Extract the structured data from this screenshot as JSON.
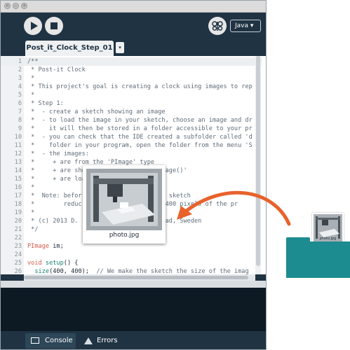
{
  "toolbar": {
    "mode_label": "Java ▾"
  },
  "tabs": {
    "sketch_tab": "Post_it_Clock_Step_01",
    "tab_menu_glyph": "▾"
  },
  "code_lines": [
    {
      "n": "1",
      "parts": [
        {
          "c": "cm",
          "t": "/**"
        }
      ]
    },
    {
      "n": "2",
      "parts": [
        {
          "c": "cm",
          "t": " * Post-it Clock"
        }
      ]
    },
    {
      "n": "3",
      "parts": [
        {
          "c": "cm",
          "t": " *"
        }
      ]
    },
    {
      "n": "4",
      "parts": [
        {
          "c": "cm",
          "t": " * This project's goal is creating a clock using images to rep"
        }
      ]
    },
    {
      "n": "5",
      "parts": [
        {
          "c": "cm",
          "t": " *"
        }
      ]
    },
    {
      "n": "6",
      "parts": [
        {
          "c": "cm",
          "t": " * Step 1:"
        }
      ]
    },
    {
      "n": "7",
      "parts": [
        {
          "c": "cm",
          "t": " *  - create a sketch showing an image"
        }
      ]
    },
    {
      "n": "8",
      "parts": [
        {
          "c": "cm",
          "t": " *  - to load the image in your sketch, choose an image and dr"
        }
      ]
    },
    {
      "n": "9",
      "parts": [
        {
          "c": "cm",
          "t": " *    it will then be stored in a folder accessible to your pr"
        }
      ]
    },
    {
      "n": "10",
      "parts": [
        {
          "c": "cm",
          "t": " *  - you can check that the IDE created a subfolder called 'd"
        }
      ]
    },
    {
      "n": "11",
      "parts": [
        {
          "c": "cm",
          "t": " *    folder in your program, open the folder from the menu 'S"
        }
      ]
    },
    {
      "n": "12",
      "parts": [
        {
          "c": "cm",
          "t": " *  - the images:"
        }
      ]
    },
    {
      "n": "13",
      "parts": [
        {
          "c": "cm",
          "t": " *     + are from the 'PImage' type"
        }
      ]
    },
    {
      "n": "14",
      "parts": [
        {
          "c": "cm",
          "t": " *     + are sho                   'image()'"
        }
      ]
    },
    {
      "n": "15",
      "parts": [
        {
          "c": "cm",
          "t": " *     + are loa                 )'"
        }
      ]
    },
    {
      "n": "16",
      "parts": [
        {
          "c": "cm",
          "t": " *"
        }
      ]
    },
    {
      "n": "17",
      "parts": [
        {
          "c": "cm",
          "t": " *  Note: befor                 into a sketch"
        }
      ]
    },
    {
      "n": "18",
      "parts": [
        {
          "c": "cm",
          "t": " *        reduc                 e 400x400 pixels of the pr"
        }
      ]
    },
    {
      "n": "19",
      "parts": [
        {
          "c": "cm",
          "t": " *"
        }
      ]
    },
    {
      "n": "20",
      "parts": [
        {
          "c": "cm",
          "t": " * (c) 2013 D.                  Verkstad, Sweden"
        }
      ]
    },
    {
      "n": "21",
      "parts": [
        {
          "c": "cm",
          "t": " */"
        }
      ]
    },
    {
      "n": "22",
      "parts": [
        {
          "c": "tx",
          "t": ""
        }
      ]
    },
    {
      "n": "23",
      "parts": [
        {
          "c": "kw",
          "t": "PImage"
        },
        {
          "c": "tx",
          "t": " im;"
        }
      ]
    },
    {
      "n": "24",
      "parts": [
        {
          "c": "tx",
          "t": ""
        }
      ]
    },
    {
      "n": "25",
      "parts": [
        {
          "c": "kw",
          "t": "void"
        },
        {
          "c": "tx",
          "t": " "
        },
        {
          "c": "fn",
          "t": "setup"
        },
        {
          "c": "tx",
          "t": "() {"
        }
      ]
    },
    {
      "n": "26",
      "parts": [
        {
          "c": "tx",
          "t": "  "
        },
        {
          "c": "fn",
          "t": "size"
        },
        {
          "c": "tx",
          "t": "(400, 400);  "
        },
        {
          "c": "cm",
          "t": "// We make the sketch the size of the imag"
        }
      ]
    }
  ],
  "popup": {
    "filename": "photo.jpg"
  },
  "thumbnail": {
    "filename": "photo.jpg"
  },
  "bottom_tabs": {
    "console": "Console",
    "errors": "Errors"
  },
  "colors": {
    "window_bg": "#1f3343",
    "keyword": "#d35b4c",
    "function": "#1a8070",
    "comment": "#5e6d7a",
    "folder": "#1d8c90",
    "arrow": "#e8622c"
  }
}
